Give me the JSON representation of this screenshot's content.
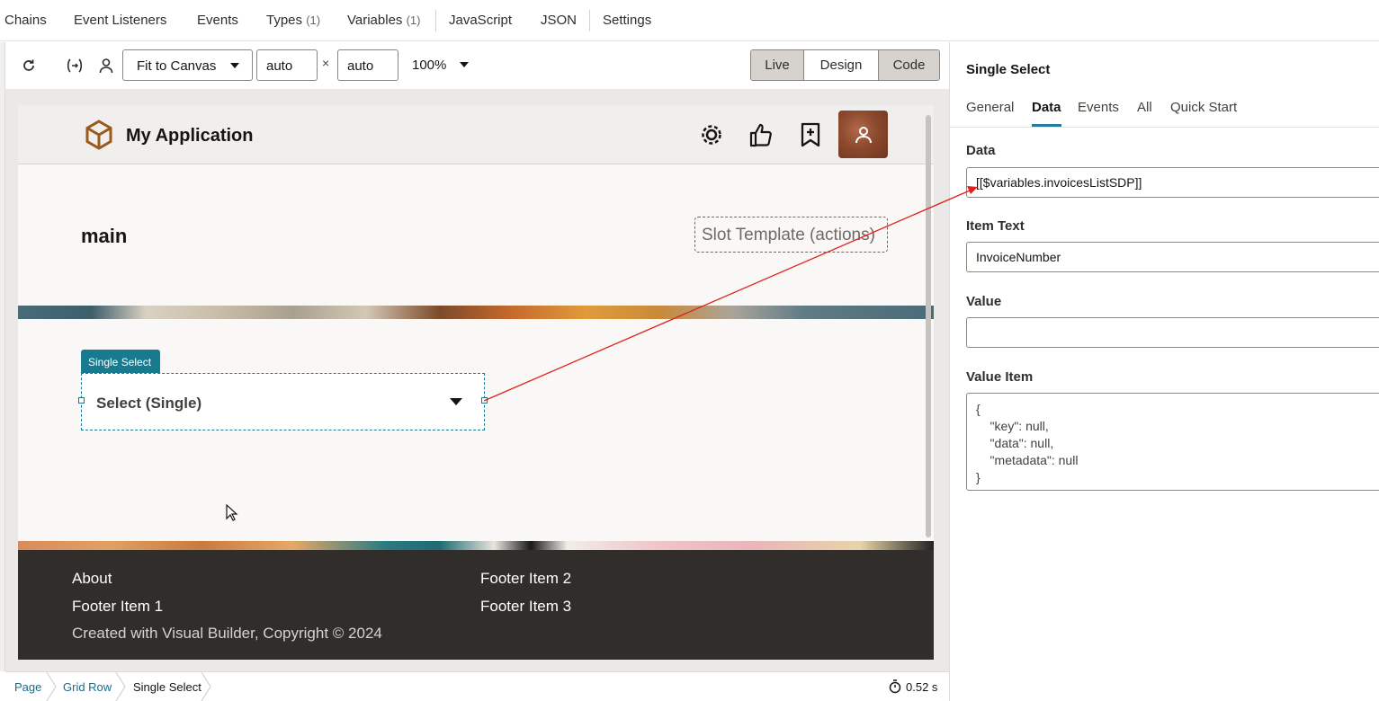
{
  "top_tabs": [
    {
      "label": "Chains"
    },
    {
      "label": "Event Listeners"
    },
    {
      "label": "Events"
    },
    {
      "label": "Types",
      "count": "(1)"
    },
    {
      "label": "Variables",
      "count": "(1)"
    },
    {
      "label": "JavaScript"
    },
    {
      "label": "JSON"
    },
    {
      "label": "Settings"
    }
  ],
  "toolbar": {
    "fit_label": "Fit to Canvas",
    "width_value": "auto",
    "times": "×",
    "height_value": "auto",
    "zoom": "100%",
    "modes": [
      {
        "label": "Live",
        "active": true
      },
      {
        "label": "Design",
        "active": false
      },
      {
        "label": "Code",
        "active": true
      }
    ]
  },
  "app": {
    "title": "My Application",
    "main_title": "main",
    "slot_label": "Slot Template (actions)",
    "select_badge": "Single Select",
    "select_placeholder": "Select (Single)",
    "footer": {
      "about": "About",
      "item1": "Footer Item 1",
      "item2": "Footer Item 2",
      "item3": "Footer Item 3",
      "copyright": "Created with Visual Builder, Copyright © 2024"
    }
  },
  "breadcrumb": [
    {
      "label": "Page"
    },
    {
      "label": "Grid Row"
    },
    {
      "label": "Single Select"
    }
  ],
  "timer": "0.52 s",
  "panel": {
    "title": "Single Select",
    "tabs": [
      {
        "label": "General"
      },
      {
        "label": "Data"
      },
      {
        "label": "Events"
      },
      {
        "label": "All"
      },
      {
        "label": "Quick Start"
      }
    ],
    "data_label": "Data",
    "data_value": "[[$variables.invoicesListSDP]]",
    "item_text_label": "Item Text",
    "item_text_value": "InvoiceNumber",
    "value_label": "Value",
    "value_value": "",
    "value_item_label": "Value Item",
    "value_item_lines": [
      "{",
      "    \"key\": null,",
      "    \"data\": null,",
      "    \"metadata\": null",
      "}"
    ]
  },
  "colors": {
    "accent": "#187a8f",
    "footer_bg": "#312d2a",
    "annotation_arrow": "#e0201b"
  }
}
